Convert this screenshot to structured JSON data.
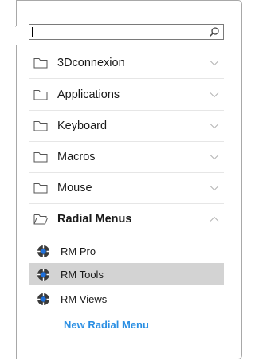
{
  "search": {
    "value": "",
    "placeholder": ""
  },
  "folders": [
    {
      "label": "3Dconnexion",
      "expanded": false
    },
    {
      "label": "Applications",
      "expanded": false
    },
    {
      "label": "Keyboard",
      "expanded": false
    },
    {
      "label": "Macros",
      "expanded": false
    },
    {
      "label": "Mouse",
      "expanded": false
    },
    {
      "label": "Radial Menus",
      "expanded": true
    }
  ],
  "radial_menus": [
    {
      "label": "RM Pro",
      "selected": false
    },
    {
      "label": "RM Tools",
      "selected": true
    },
    {
      "label": "RM Views",
      "selected": false
    }
  ],
  "new_radial_menu_label": "New Radial Menu",
  "colors": {
    "link": "#2b8fe3",
    "selected_row": "#d3d3d3",
    "icon_blue": "#1e6fd9"
  }
}
